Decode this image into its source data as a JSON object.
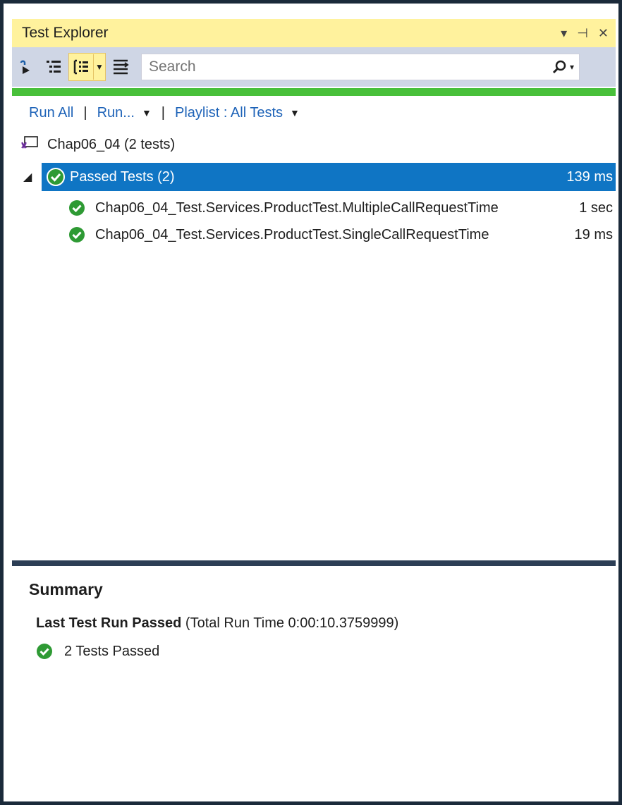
{
  "window": {
    "title": "Test Explorer",
    "controls": {
      "dropdown": "▾",
      "pin": "⊣",
      "close": "✕"
    }
  },
  "toolbar": {
    "search_placeholder": "Search",
    "icons": [
      "run-tests-icon",
      "group-by-icon",
      "show-details-icon",
      "playlist-icon"
    ]
  },
  "colors": {
    "title_bg": "#fff29d",
    "toolbar_bg": "#cfd6e5",
    "progress": "#48c03a",
    "selection": "#0f75c4",
    "link": "#1e63b8",
    "pass": "#2e9a34"
  },
  "commands": {
    "run_all": "Run All",
    "run": "Run...",
    "playlist": "Playlist : All Tests"
  },
  "tree": {
    "project": "Chap06_04 (2 tests)",
    "group": {
      "label": "Passed Tests (2)",
      "time": "139 ms"
    },
    "tests": [
      {
        "name": "Chap06_04_Test.Services.ProductTest.MultipleCallRequestTime",
        "time": "1 sec",
        "status": "passed"
      },
      {
        "name": "Chap06_04_Test.Services.ProductTest.SingleCallRequestTime",
        "time": "19 ms",
        "status": "passed"
      }
    ]
  },
  "summary": {
    "title": "Summary",
    "last_run_label": "Last Test Run Passed",
    "total_run_time": "(Total Run Time 0:00:10.3759999)",
    "passed_count": "2 Tests Passed"
  }
}
